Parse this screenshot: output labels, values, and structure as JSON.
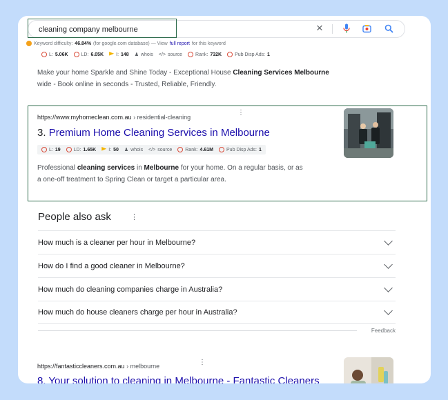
{
  "search": {
    "query": "cleaning company melbourne"
  },
  "keyword": {
    "label": "Keyword difficulty:",
    "value": "46.84%",
    "db": "(for google.com database) — View",
    "link": "full report",
    "suffix": "for this keyword"
  },
  "prev_result": {
    "metrics": {
      "l": "L:",
      "l_val": "5.06K",
      "ld": "LD:",
      "ld_val": "6.05K",
      "i": "I:",
      "i_val": "148",
      "whois": "whois",
      "source": "source",
      "rank": "Rank:",
      "rank_val": "732K",
      "ads": "Pub Disp Ads:",
      "ads_val": "1"
    },
    "snippet_1": "Make your home Sparkle and Shine Today - Exceptional House ",
    "snippet_bold": "Cleaning Services Melbourne",
    "snippet_2": "wide - Book online in seconds - Trusted, Reliable, Friendly."
  },
  "result_3": {
    "url": "https://www.myhomeclean.com.au",
    "crumb": "› residential-cleaning",
    "number": "3.",
    "title": "Premium Home Cleaning Services in Melbourne",
    "metrics": {
      "l": "L:",
      "l_val": "19",
      "ld": "LD:",
      "ld_val": "1.65K",
      "i": "I:",
      "i_val": "50",
      "whois": "whois",
      "source": "source",
      "rank": "Rank:",
      "rank_val": "4.61M",
      "ads": "Pub Disp Ads:",
      "ads_val": "1"
    },
    "s1": "Professional ",
    "b1": "cleaning services",
    "s2": " in ",
    "b2": "Melbourne",
    "s3": " for your home. On a regular basis, or as",
    "line2": "a one-off treatment to Spring Clean or target a particular area."
  },
  "paa": {
    "title": "People also ask",
    "questions": [
      "How much is a cleaner per hour in Melbourne?",
      "How do I find a good cleaner in Melbourne?",
      "How much do cleaning companies charge in Australia?",
      "How much do house cleaners charge per hour in Australia?"
    ],
    "feedback": "Feedback"
  },
  "result_8": {
    "url": "https://fantasticcleaners.com.au",
    "crumb": "› melbourne",
    "title": "8. Your solution to cleaning in Melbourne - Fantastic Cleaners"
  },
  "colors": {
    "link": "#1a0dab",
    "highlight_border": "#2b6a4a",
    "background": "#c3dcfb"
  },
  "icons": [
    "close-icon",
    "mic-icon",
    "lens-icon",
    "search-icon",
    "kebab-icon",
    "chevron-down-icon",
    "whois-icon",
    "code-icon",
    "flag-icon"
  ]
}
